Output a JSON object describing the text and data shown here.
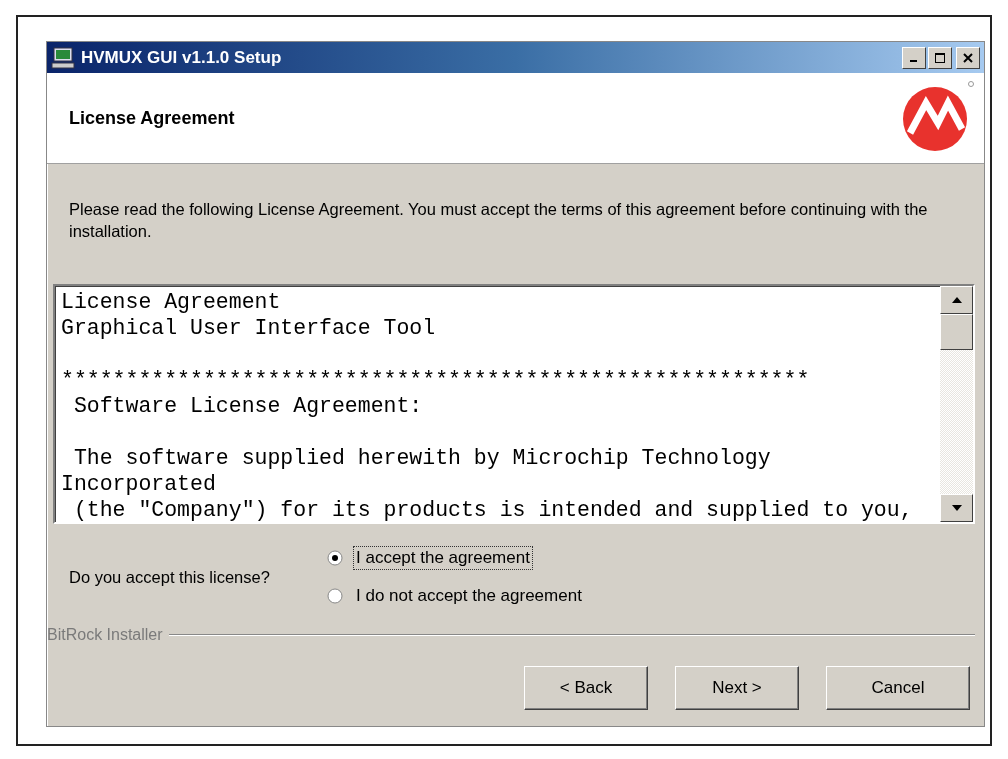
{
  "window": {
    "title": "HVMUX GUI v1.1.0 Setup"
  },
  "header": {
    "title": "License Agreement"
  },
  "intro": "Please read the following License Agreement. You must accept the terms of this agreement before continuing with the installation.",
  "license_text": {
    "paragraphs": [
      [
        "License Agreement",
        "Graphical User Interface Tool"
      ],
      [
        "**********************************************************",
        " Software License Agreement:"
      ],
      [
        " The software supplied herewith by Microchip Technology",
        "Incorporated",
        " (the \"Company\") for its products is intended and supplied to you,"
      ]
    ]
  },
  "question": "Do you accept this license?",
  "options": [
    {
      "label": "I accept the agreement",
      "selected": true
    },
    {
      "label": "I do not accept the agreement",
      "selected": false
    }
  ],
  "branding": "BitRock Installer",
  "buttons": [
    "< Back",
    "Next >",
    "Cancel"
  ]
}
